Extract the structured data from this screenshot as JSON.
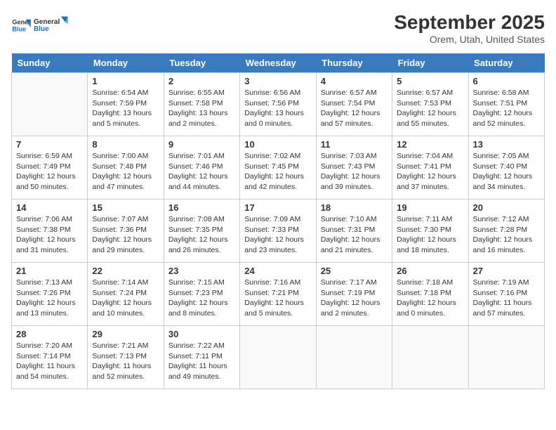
{
  "header": {
    "logo_line1": "General",
    "logo_line2": "Blue",
    "month": "September 2025",
    "location": "Orem, Utah, United States"
  },
  "days_of_week": [
    "Sunday",
    "Monday",
    "Tuesday",
    "Wednesday",
    "Thursday",
    "Friday",
    "Saturday"
  ],
  "weeks": [
    [
      {
        "day": "",
        "info": ""
      },
      {
        "day": "1",
        "info": "Sunrise: 6:54 AM\nSunset: 7:59 PM\nDaylight: 13 hours\nand 5 minutes."
      },
      {
        "day": "2",
        "info": "Sunrise: 6:55 AM\nSunset: 7:58 PM\nDaylight: 13 hours\nand 2 minutes."
      },
      {
        "day": "3",
        "info": "Sunrise: 6:56 AM\nSunset: 7:56 PM\nDaylight: 13 hours\nand 0 minutes."
      },
      {
        "day": "4",
        "info": "Sunrise: 6:57 AM\nSunset: 7:54 PM\nDaylight: 12 hours\nand 57 minutes."
      },
      {
        "day": "5",
        "info": "Sunrise: 6:57 AM\nSunset: 7:53 PM\nDaylight: 12 hours\nand 55 minutes."
      },
      {
        "day": "6",
        "info": "Sunrise: 6:58 AM\nSunset: 7:51 PM\nDaylight: 12 hours\nand 52 minutes."
      }
    ],
    [
      {
        "day": "7",
        "info": "Sunrise: 6:59 AM\nSunset: 7:49 PM\nDaylight: 12 hours\nand 50 minutes."
      },
      {
        "day": "8",
        "info": "Sunrise: 7:00 AM\nSunset: 7:48 PM\nDaylight: 12 hours\nand 47 minutes."
      },
      {
        "day": "9",
        "info": "Sunrise: 7:01 AM\nSunset: 7:46 PM\nDaylight: 12 hours\nand 44 minutes."
      },
      {
        "day": "10",
        "info": "Sunrise: 7:02 AM\nSunset: 7:45 PM\nDaylight: 12 hours\nand 42 minutes."
      },
      {
        "day": "11",
        "info": "Sunrise: 7:03 AM\nSunset: 7:43 PM\nDaylight: 12 hours\nand 39 minutes."
      },
      {
        "day": "12",
        "info": "Sunrise: 7:04 AM\nSunset: 7:41 PM\nDaylight: 12 hours\nand 37 minutes."
      },
      {
        "day": "13",
        "info": "Sunrise: 7:05 AM\nSunset: 7:40 PM\nDaylight: 12 hours\nand 34 minutes."
      }
    ],
    [
      {
        "day": "14",
        "info": "Sunrise: 7:06 AM\nSunset: 7:38 PM\nDaylight: 12 hours\nand 31 minutes."
      },
      {
        "day": "15",
        "info": "Sunrise: 7:07 AM\nSunset: 7:36 PM\nDaylight: 12 hours\nand 29 minutes."
      },
      {
        "day": "16",
        "info": "Sunrise: 7:08 AM\nSunset: 7:35 PM\nDaylight: 12 hours\nand 26 minutes."
      },
      {
        "day": "17",
        "info": "Sunrise: 7:09 AM\nSunset: 7:33 PM\nDaylight: 12 hours\nand 23 minutes."
      },
      {
        "day": "18",
        "info": "Sunrise: 7:10 AM\nSunset: 7:31 PM\nDaylight: 12 hours\nand 21 minutes."
      },
      {
        "day": "19",
        "info": "Sunrise: 7:11 AM\nSunset: 7:30 PM\nDaylight: 12 hours\nand 18 minutes."
      },
      {
        "day": "20",
        "info": "Sunrise: 7:12 AM\nSunset: 7:28 PM\nDaylight: 12 hours\nand 16 minutes."
      }
    ],
    [
      {
        "day": "21",
        "info": "Sunrise: 7:13 AM\nSunset: 7:26 PM\nDaylight: 12 hours\nand 13 minutes."
      },
      {
        "day": "22",
        "info": "Sunrise: 7:14 AM\nSunset: 7:24 PM\nDaylight: 12 hours\nand 10 minutes."
      },
      {
        "day": "23",
        "info": "Sunrise: 7:15 AM\nSunset: 7:23 PM\nDaylight: 12 hours\nand 8 minutes."
      },
      {
        "day": "24",
        "info": "Sunrise: 7:16 AM\nSunset: 7:21 PM\nDaylight: 12 hours\nand 5 minutes."
      },
      {
        "day": "25",
        "info": "Sunrise: 7:17 AM\nSunset: 7:19 PM\nDaylight: 12 hours\nand 2 minutes."
      },
      {
        "day": "26",
        "info": "Sunrise: 7:18 AM\nSunset: 7:18 PM\nDaylight: 12 hours\nand 0 minutes."
      },
      {
        "day": "27",
        "info": "Sunrise: 7:19 AM\nSunset: 7:16 PM\nDaylight: 11 hours\nand 57 minutes."
      }
    ],
    [
      {
        "day": "28",
        "info": "Sunrise: 7:20 AM\nSunset: 7:14 PM\nDaylight: 11 hours\nand 54 minutes."
      },
      {
        "day": "29",
        "info": "Sunrise: 7:21 AM\nSunset: 7:13 PM\nDaylight: 11 hours\nand 52 minutes."
      },
      {
        "day": "30",
        "info": "Sunrise: 7:22 AM\nSunset: 7:11 PM\nDaylight: 11 hours\nand 49 minutes."
      },
      {
        "day": "",
        "info": ""
      },
      {
        "day": "",
        "info": ""
      },
      {
        "day": "",
        "info": ""
      },
      {
        "day": "",
        "info": ""
      }
    ]
  ]
}
